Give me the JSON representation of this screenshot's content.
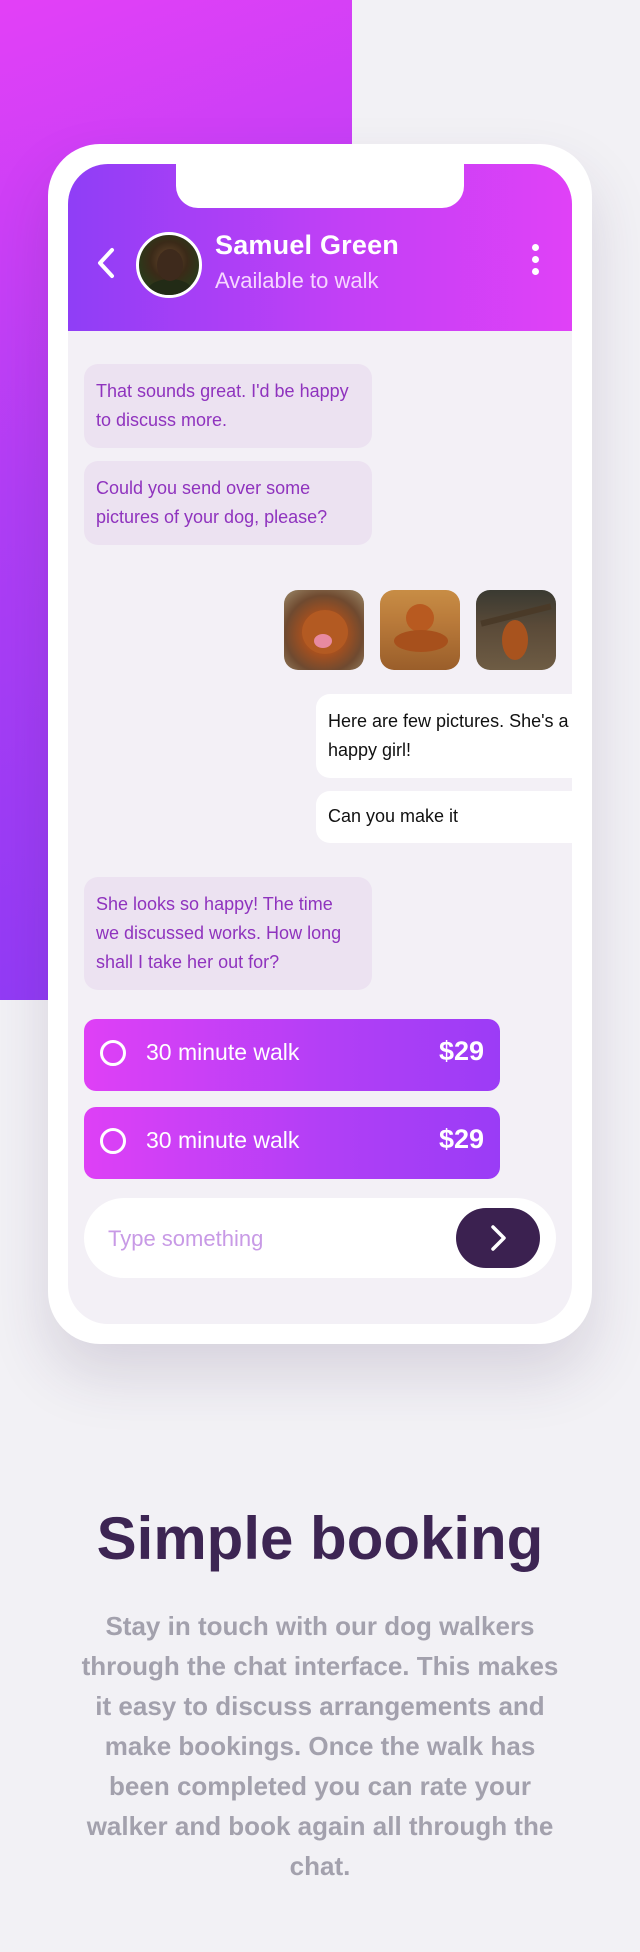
{
  "chat": {
    "contact_name": "Samuel Green",
    "contact_status": "Available to walk",
    "messages": [
      {
        "from": "walker",
        "text": "That sounds great. I'd be happy to discuss more."
      },
      {
        "from": "walker",
        "text": "Could you send over some pictures of your dog, please?"
      },
      {
        "from": "owner",
        "text": "Here are few pictures. She's a happy girl!"
      },
      {
        "from": "owner",
        "text": "Can you make it"
      },
      {
        "from": "walker",
        "text": "She looks so happy! The time we discussed works. How long shall I take her out for?"
      }
    ],
    "photos": [
      "dog-photo-1",
      "dog-photo-2",
      "dog-photo-3"
    ],
    "options": [
      {
        "label": "30 minute walk",
        "price": "$29"
      },
      {
        "label": "30 minute walk",
        "price": "$29"
      }
    ],
    "composer": {
      "placeholder": "Type something",
      "value": ""
    }
  },
  "icons": {
    "back": "chevron-left-icon",
    "menu": "more-vertical-icon",
    "send": "chevron-right-icon"
  },
  "promo": {
    "headline": "Simple booking",
    "body": "Stay in touch with our dog walkers through the chat interface. This makes it easy to discuss arrangements and make bookings. Once the walk has been completed you can rate your walker and book again all through the chat."
  },
  "colors": {
    "accent_gradient_start": "#e340f7",
    "accent_gradient_end": "#8b3af5",
    "send_button": "#3b2150",
    "walker_bubble_bg": "#ece2f1",
    "walker_bubble_text": "#8f33be",
    "headline": "#3d2553",
    "body": "#a3a1ad"
  }
}
